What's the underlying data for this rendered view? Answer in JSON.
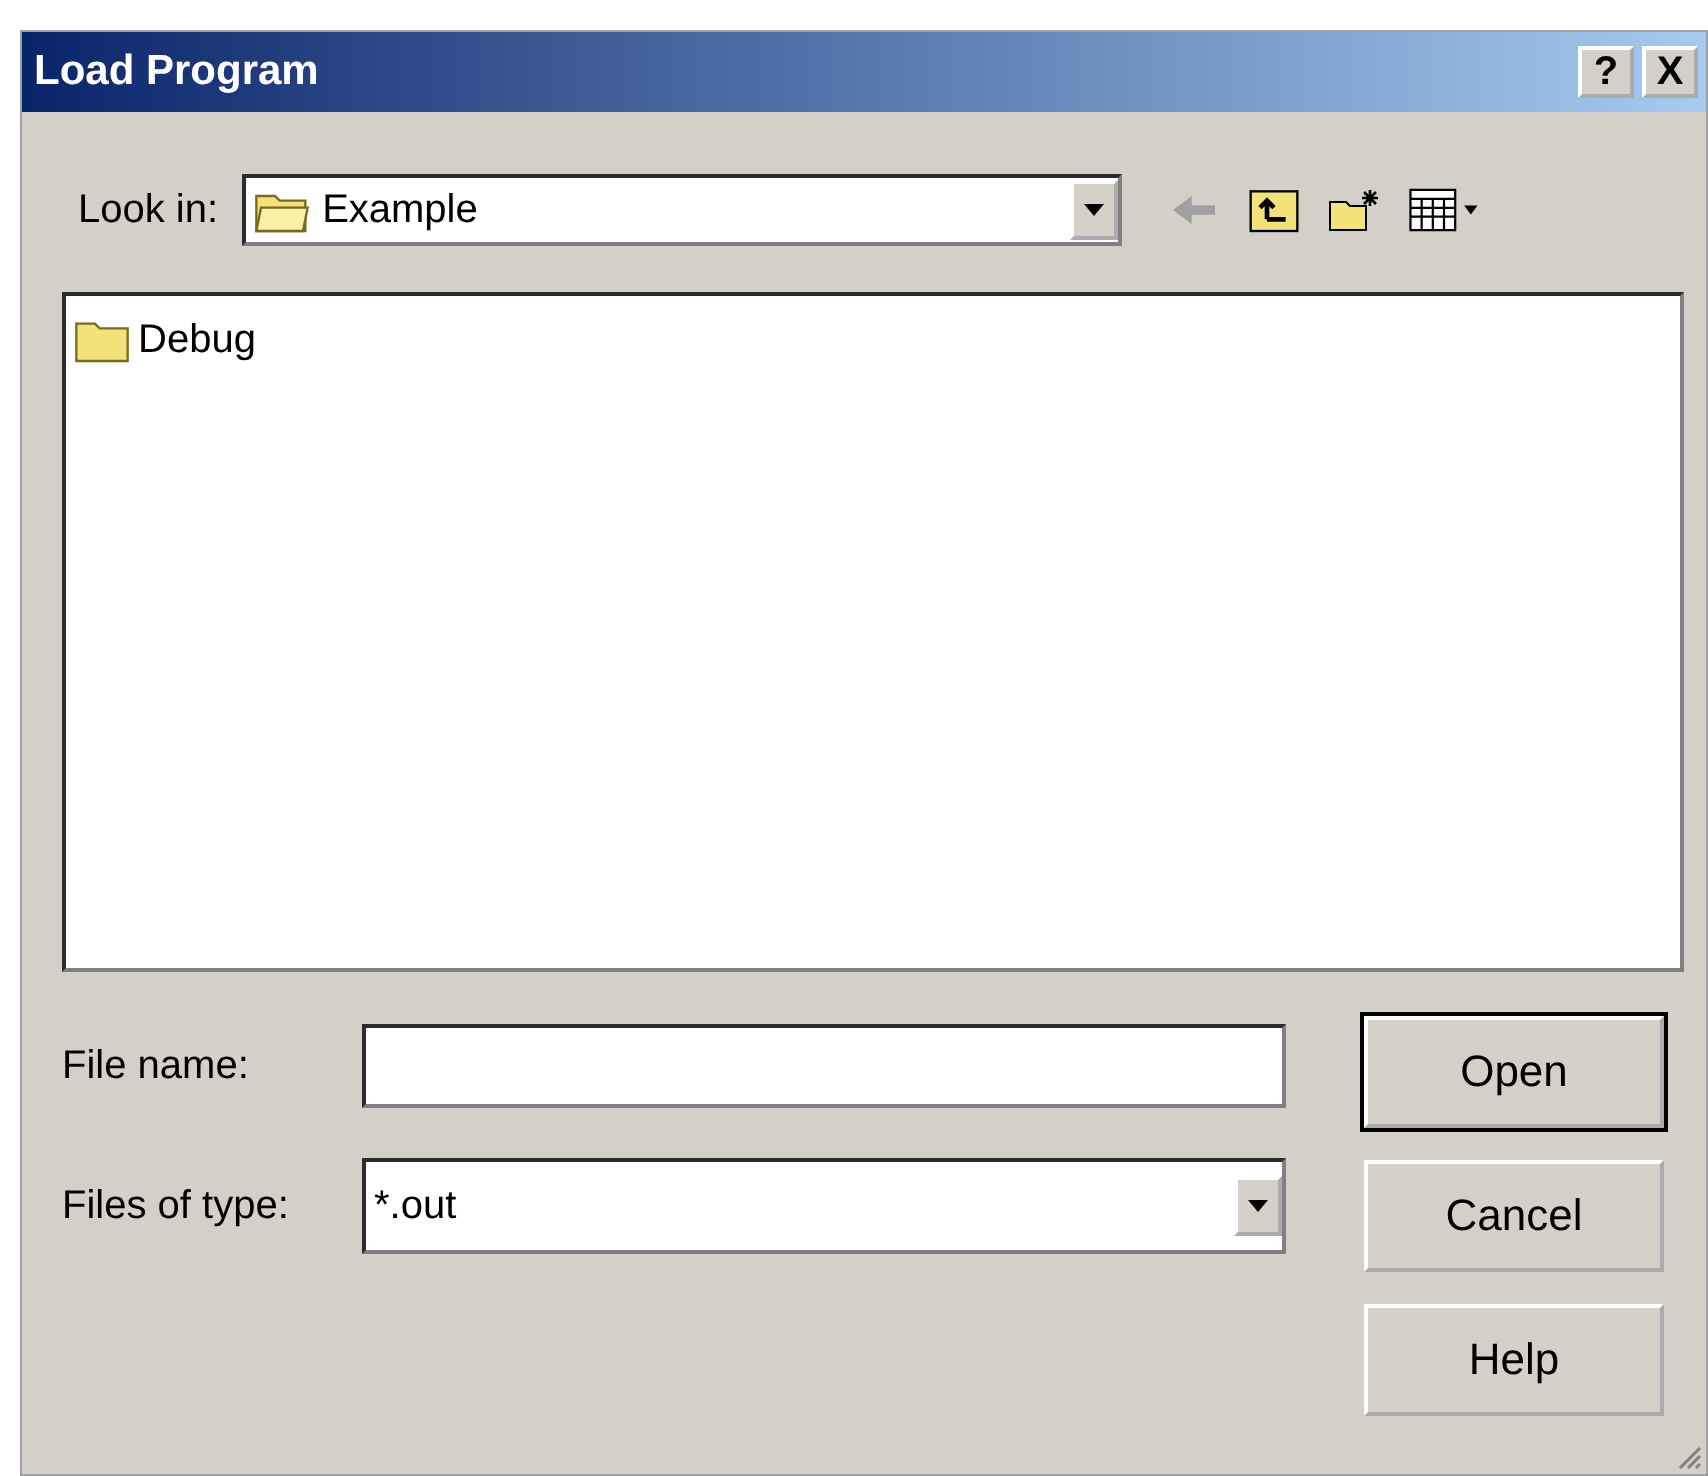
{
  "window": {
    "title": "Load Program",
    "controls": [
      "?",
      "X"
    ]
  },
  "look_in": {
    "label": "Look in:",
    "value": "Example"
  },
  "files": [
    {
      "name": "Debug",
      "kind": "folder",
      "selected": false
    }
  ],
  "file_name": {
    "label": "File name:"
  },
  "files_of_type": {
    "label": "Files of type:",
    "value": "*.out"
  },
  "buttons": [
    {
      "label": "Open",
      "default": true
    },
    {
      "label": "Cancel",
      "default": false
    },
    {
      "label": "Help",
      "default": false
    }
  ]
}
